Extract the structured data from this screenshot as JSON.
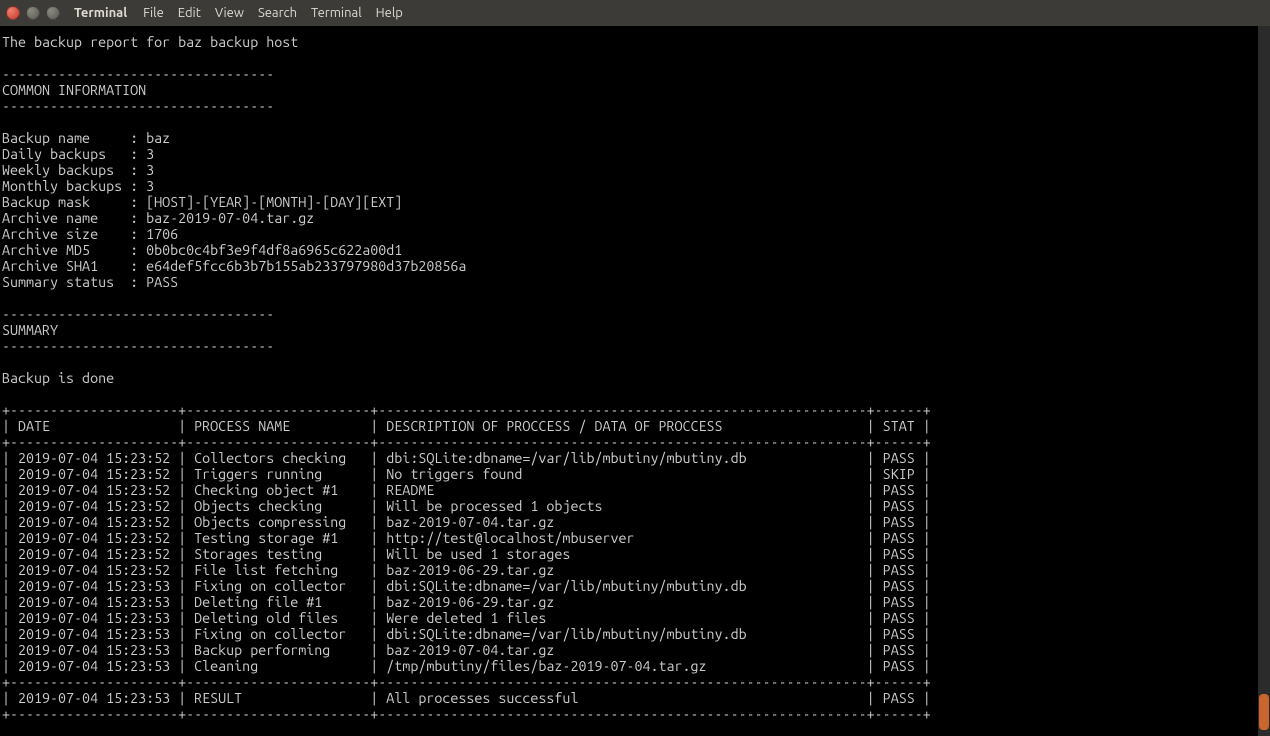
{
  "menubar": {
    "title": "Terminal",
    "items": [
      "File",
      "Edit",
      "View",
      "Search",
      "Terminal",
      "Help"
    ]
  },
  "report": {
    "header_line": "The backup report for baz backup host",
    "dashes_common": "----------------------------------",
    "section_common": "COMMON INFORMATION",
    "fields": [
      {
        "label": "Backup name     ",
        "value": "baz"
      },
      {
        "label": "Daily backups   ",
        "value": "3"
      },
      {
        "label": "Weekly backups  ",
        "value": "3"
      },
      {
        "label": "Monthly backups ",
        "value": "3"
      },
      {
        "label": "Backup mask     ",
        "value": "[HOST]-[YEAR]-[MONTH]-[DAY][EXT]"
      },
      {
        "label": "Archive name    ",
        "value": "baz-2019-07-04.tar.gz"
      },
      {
        "label": "Archive size    ",
        "value": "1706"
      },
      {
        "label": "Archive MD5     ",
        "value": "0b0bc0c4bf3e9f4df8a6965c622a00d1"
      },
      {
        "label": "Archive SHA1    ",
        "value": "e64def5fcc6b3b7b155ab233797980d37b20856a"
      },
      {
        "label": "Summary status  ",
        "value": "PASS"
      }
    ],
    "section_summary": "SUMMARY",
    "summary_text": "Backup is done",
    "table_header": {
      "date": "DATE",
      "process": "PROCESS NAME",
      "desc": "DESCRIPTION OF PROCCESS / DATA OF PROCCESS",
      "stat": "STAT"
    },
    "rows": [
      {
        "date": "2019-07-04 15:23:52",
        "proc": "Collectors checking",
        "desc": "dbi:SQLite:dbname=/var/lib/mbutiny/mbutiny.db",
        "stat": "PASS"
      },
      {
        "date": "2019-07-04 15:23:52",
        "proc": "Triggers running",
        "desc": "No triggers found",
        "stat": "SKIP"
      },
      {
        "date": "2019-07-04 15:23:52",
        "proc": "Checking object #1",
        "desc": "README",
        "stat": "PASS"
      },
      {
        "date": "2019-07-04 15:23:52",
        "proc": "Objects checking",
        "desc": "Will be processed 1 objects",
        "stat": "PASS"
      },
      {
        "date": "2019-07-04 15:23:52",
        "proc": "Objects compressing",
        "desc": "baz-2019-07-04.tar.gz",
        "stat": "PASS"
      },
      {
        "date": "2019-07-04 15:23:52",
        "proc": "Testing storage #1",
        "desc": "http://test@localhost/mbuserver",
        "stat": "PASS"
      },
      {
        "date": "2019-07-04 15:23:52",
        "proc": "Storages testing",
        "desc": "Will be used 1 storages",
        "stat": "PASS"
      },
      {
        "date": "2019-07-04 15:23:52",
        "proc": "File list fetching",
        "desc": "baz-2019-06-29.tar.gz",
        "stat": "PASS"
      },
      {
        "date": "2019-07-04 15:23:53",
        "proc": "Fixing on collector",
        "desc": "dbi:SQLite:dbname=/var/lib/mbutiny/mbutiny.db",
        "stat": "PASS"
      },
      {
        "date": "2019-07-04 15:23:53",
        "proc": "Deleting file #1",
        "desc": "baz-2019-06-29.tar.gz",
        "stat": "PASS"
      },
      {
        "date": "2019-07-04 15:23:53",
        "proc": "Deleting old files",
        "desc": "Were deleted 1 files",
        "stat": "PASS"
      },
      {
        "date": "2019-07-04 15:23:53",
        "proc": "Fixing on collector",
        "desc": "dbi:SQLite:dbname=/var/lib/mbutiny/mbutiny.db",
        "stat": "PASS"
      },
      {
        "date": "2019-07-04 15:23:53",
        "proc": "Backup performing",
        "desc": "baz-2019-07-04.tar.gz",
        "stat": "PASS"
      },
      {
        "date": "2019-07-04 15:23:53",
        "proc": "Cleaning",
        "desc": "/tmp/mbutiny/files/baz-2019-07-04.tar.gz",
        "stat": "PASS"
      }
    ],
    "result_row": {
      "date": "2019-07-04 15:23:53",
      "proc": "RESULT",
      "desc": "All processes successful",
      "stat": "PASS"
    }
  }
}
